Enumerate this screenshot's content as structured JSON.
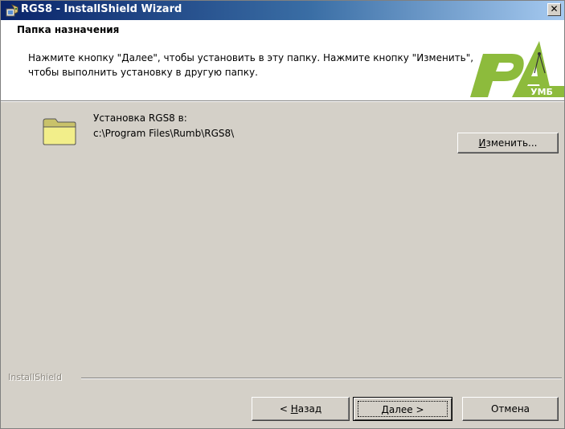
{
  "window": {
    "title": "RGS8 - InstallShield Wizard",
    "close_glyph": "✕"
  },
  "header": {
    "title": "Папка назначения",
    "description": "Нажмите кнопку \"Далее\", чтобы установить в эту папку. Нажмите кнопку \"Изменить\", чтобы выполнить установку в другую папку.",
    "logo_text": "УМБ"
  },
  "destination": {
    "label": "Установка RGS8 в:",
    "path": "c:\\Program Files\\Rumb\\RGS8\\",
    "change_button": {
      "mnemonic": "И",
      "rest": "зменить..."
    }
  },
  "footer": {
    "brand": "InstallShield",
    "back_button": {
      "prefix": "< ",
      "mnemonic": "Н",
      "rest": "азад"
    },
    "next_button": {
      "mnemonic": "Д",
      "rest": "алее >"
    },
    "cancel_button": "Отмена"
  },
  "icons": [
    "installer-app-icon",
    "close-icon",
    "folder-icon",
    "rumb-logo"
  ],
  "colors": {
    "titlebar_start": "#0a246a",
    "titlebar_end": "#a6caf0",
    "dialog_bg": "#d4d0c8",
    "logo_green": "#8dbb3c",
    "folder_yellow": "#f2ee8a"
  }
}
